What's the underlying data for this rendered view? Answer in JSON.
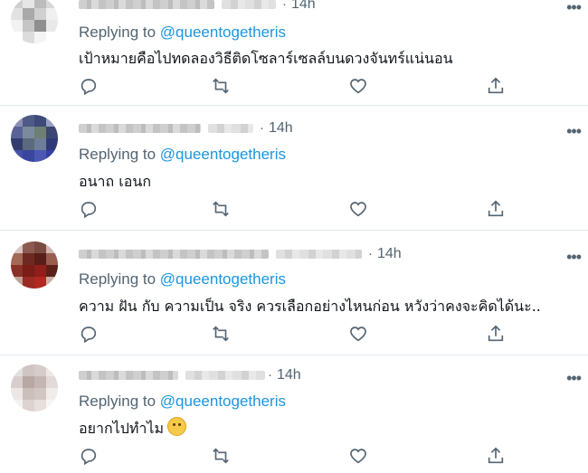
{
  "tweets": [
    {
      "time": "14h",
      "replying_prefix": "Replying to",
      "handle": "@queentogetheris",
      "text": "เป้าหมายคือไปทดลองวิธีติดโซลาร์เซลล์บนดวงจันทร์แน่นอน",
      "more": "•••"
    },
    {
      "time": "14h",
      "replying_prefix": "Replying to",
      "handle": "@queentogetheris",
      "text": "อนาถ เอนก",
      "more": "•••"
    },
    {
      "time": "14h",
      "replying_prefix": "Replying to",
      "handle": "@queentogetheris",
      "text": "ความ ฝัน กับ ความเป็น จริง ควรเลือกอย่างไหนก่อน หวังว่าคงจะคิดได้นะ..",
      "more": "•••"
    },
    {
      "time": "14h",
      "replying_prefix": "Replying to",
      "handle": "@queentogetheris",
      "text": "อยากไปทำไม",
      "more": "•••"
    }
  ],
  "separator": "·",
  "icons": [
    "reply-icon",
    "retweet-icon",
    "like-icon",
    "share-icon",
    "more-icon"
  ],
  "colors": {
    "link": "#1b95e0",
    "muted": "#536471",
    "border": "#e1e8ed"
  }
}
